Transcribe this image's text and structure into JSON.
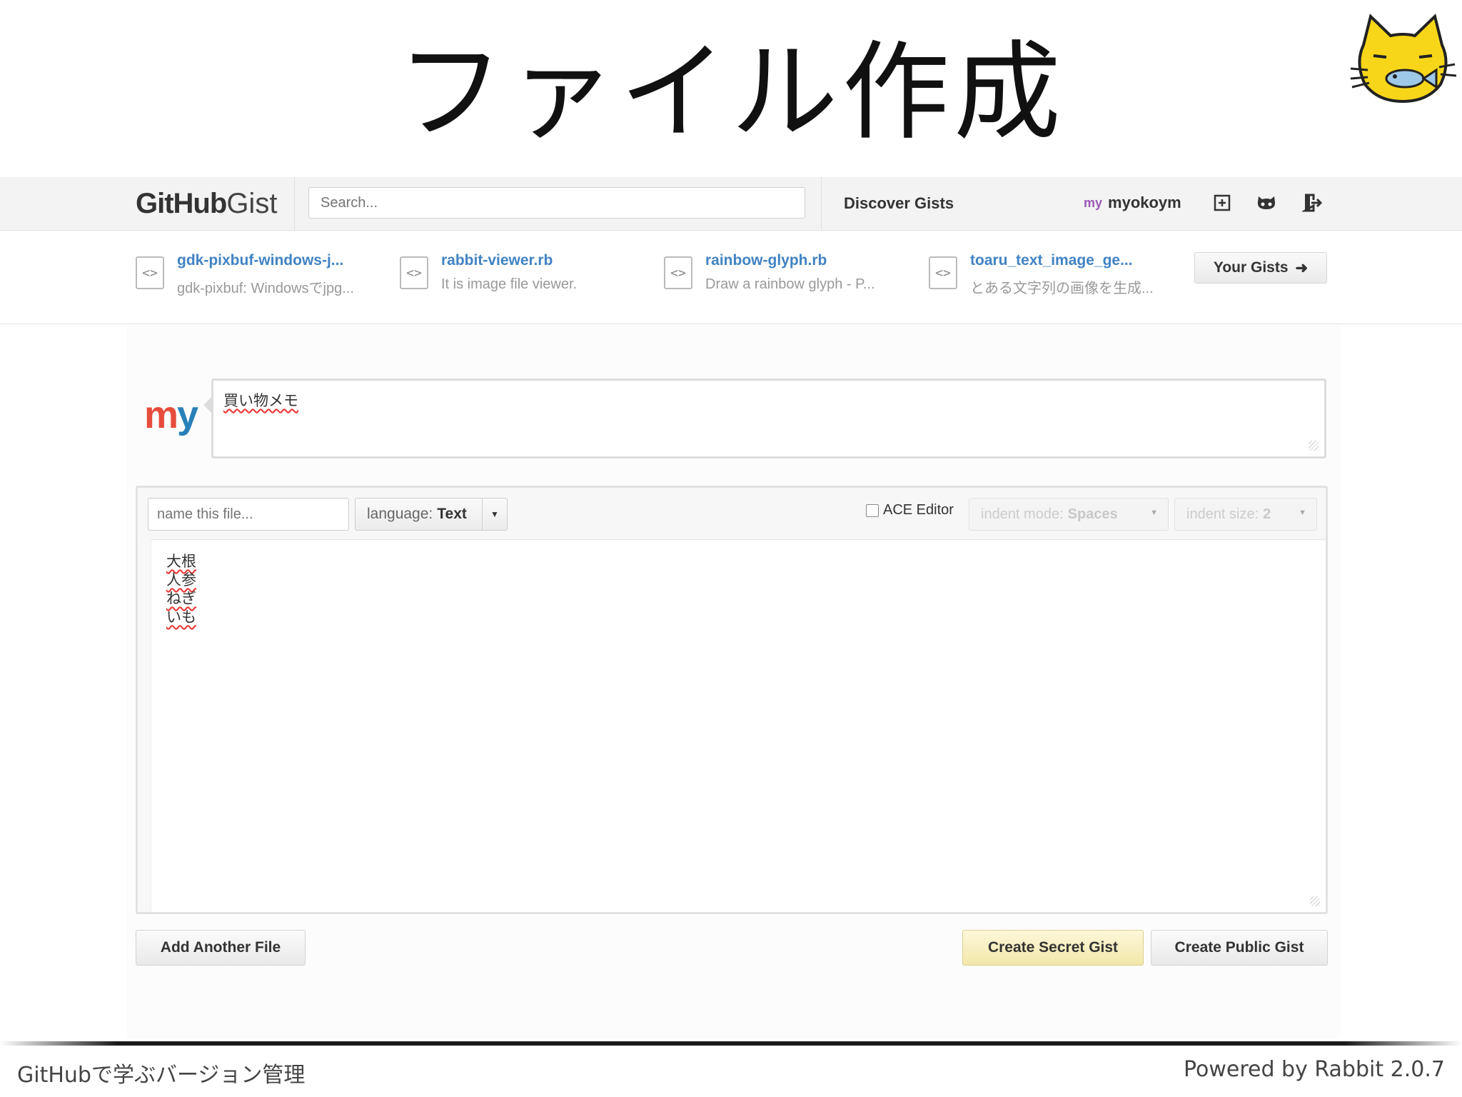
{
  "slide": {
    "title": "ファイル作成",
    "footer_left": "GitHubで学ぶバージョン管理",
    "footer_right": "Powered by Rabbit 2.0.7"
  },
  "header": {
    "logo_bold": "GitHub",
    "logo_light": "Gist",
    "search_placeholder": "Search...",
    "discover_label": "Discover Gists",
    "avatar_text": "my",
    "username": "myokoym",
    "icons": [
      "new-gist-icon",
      "octocat-icon",
      "sign-out-icon"
    ]
  },
  "recent_gists": [
    {
      "name": "gdk-pixbuf-windows-j...",
      "description": "gdk-pixbuf: Windowsでjpg..."
    },
    {
      "name": "rabbit-viewer.rb",
      "description": "It is image file viewer."
    },
    {
      "name": "rainbow-glyph.rb",
      "description": "Draw a rainbow glyph - P..."
    },
    {
      "name": "toaru_text_image_ge...",
      "description": "とある文字列の画像を生成..."
    }
  ],
  "your_gists_label": "Your Gists",
  "avatar_big": [
    "m",
    "y"
  ],
  "description_value": "買い物メモ",
  "editor": {
    "filename_placeholder": "name this file...",
    "language_prefix": "language:",
    "language_value": "Text",
    "ace_label": "ACE Editor",
    "ace_checked": false,
    "indent_mode_prefix": "indent mode:",
    "indent_mode_value": "Spaces",
    "indent_size_prefix": "indent size:",
    "indent_size_value": "2",
    "lines": [
      "大根",
      "人参",
      "ねぎ",
      "いも"
    ]
  },
  "buttons": {
    "add_file": "Add Another File",
    "create_secret": "Create Secret Gist",
    "create_public": "Create Public Gist"
  },
  "colors": {
    "link": "#4183c4",
    "secret_button": "#f2e7aa",
    "footer_bar": "#1a1a1a"
  }
}
